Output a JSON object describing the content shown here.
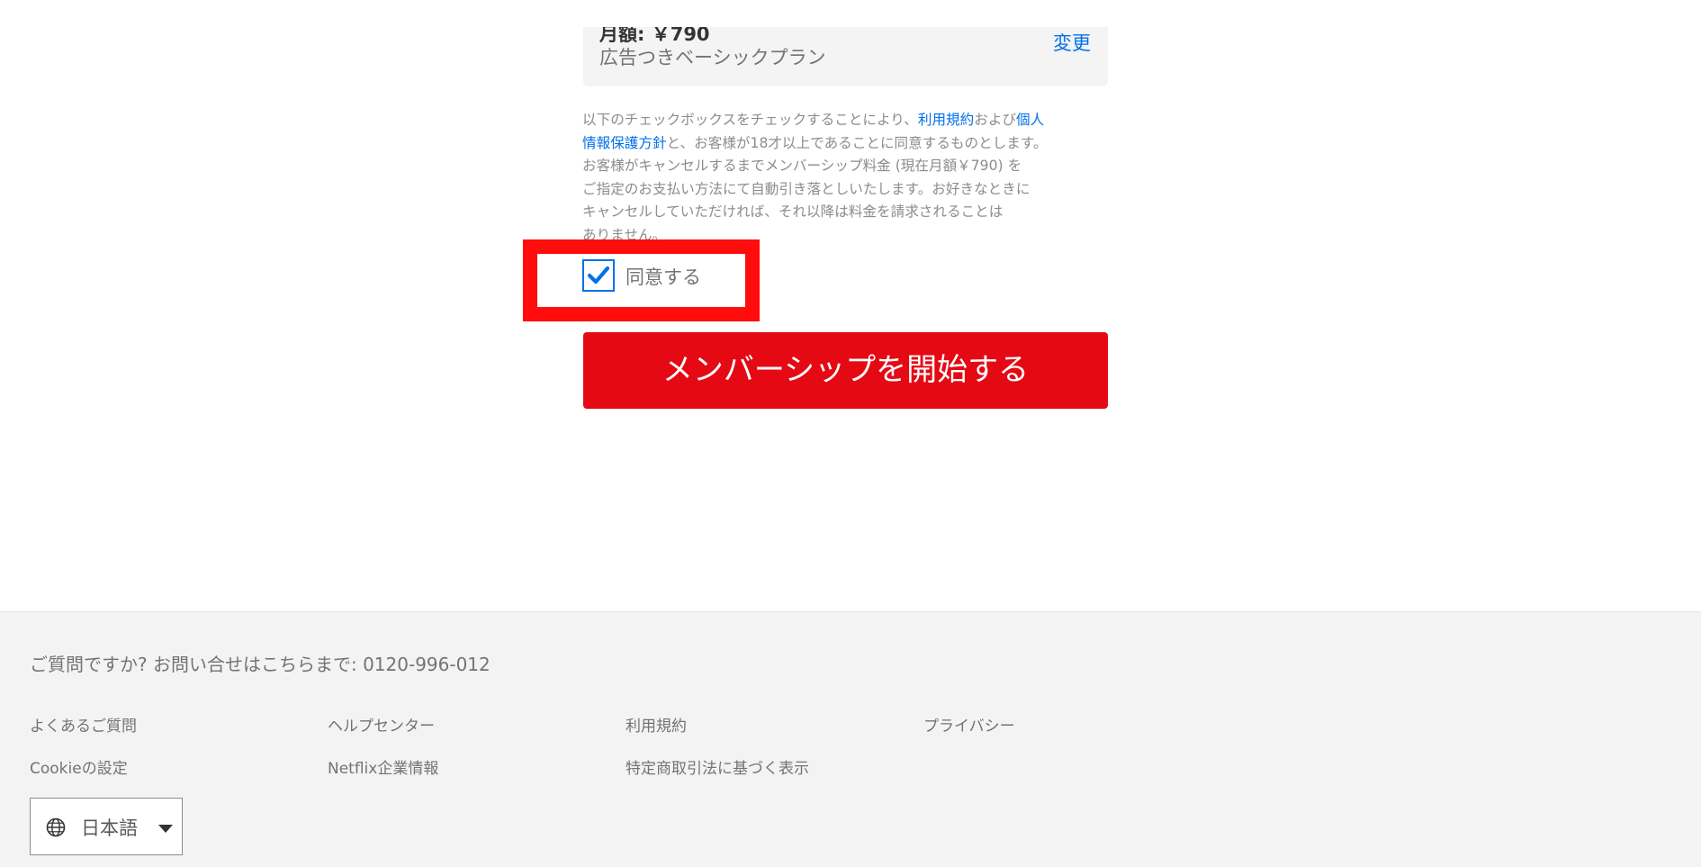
{
  "plan": {
    "price": "月額: ￥790",
    "name": "広告つきベーシックプラン",
    "change_label": "変更"
  },
  "terms": {
    "line1_text": "以下のチェックボックスをチェックすることにより、",
    "terms_link": "利用規約",
    "line1_mid": "および",
    "privacy_link_part1": "個人",
    "privacy_link_part2": "情報保護方針",
    "line2_text": "と、お客様が18才以上であることに同意するものとします。",
    "line3": "お客様がキャンセルするまでメンバーシップ料金 (現在月額￥790) を",
    "line4": "ご指定のお支払い方法にて自動引き落としいたします。お好きなときに",
    "line5": "キャンセルしていただければ、それ以降は料金を請求されることは",
    "line6": "ありません。"
  },
  "agree": {
    "label": "同意する",
    "checked": true
  },
  "start_button": {
    "label": "メンバーシップを開始する"
  },
  "footer": {
    "contact_text": "ご質問ですか? お問い合せはこちらまで: ",
    "phone": "0120-996-012",
    "links": [
      "よくあるご質問",
      "ヘルプセンター",
      "利用規約",
      "プライバシー",
      "Cookieの設定",
      "Netflix企業情報",
      "特定商取引法に基づく表示"
    ],
    "language": "日本語"
  },
  "colors": {
    "brand_red": "#e50914",
    "link_blue": "#0071eb",
    "highlight_red": "#ff0d0d"
  }
}
